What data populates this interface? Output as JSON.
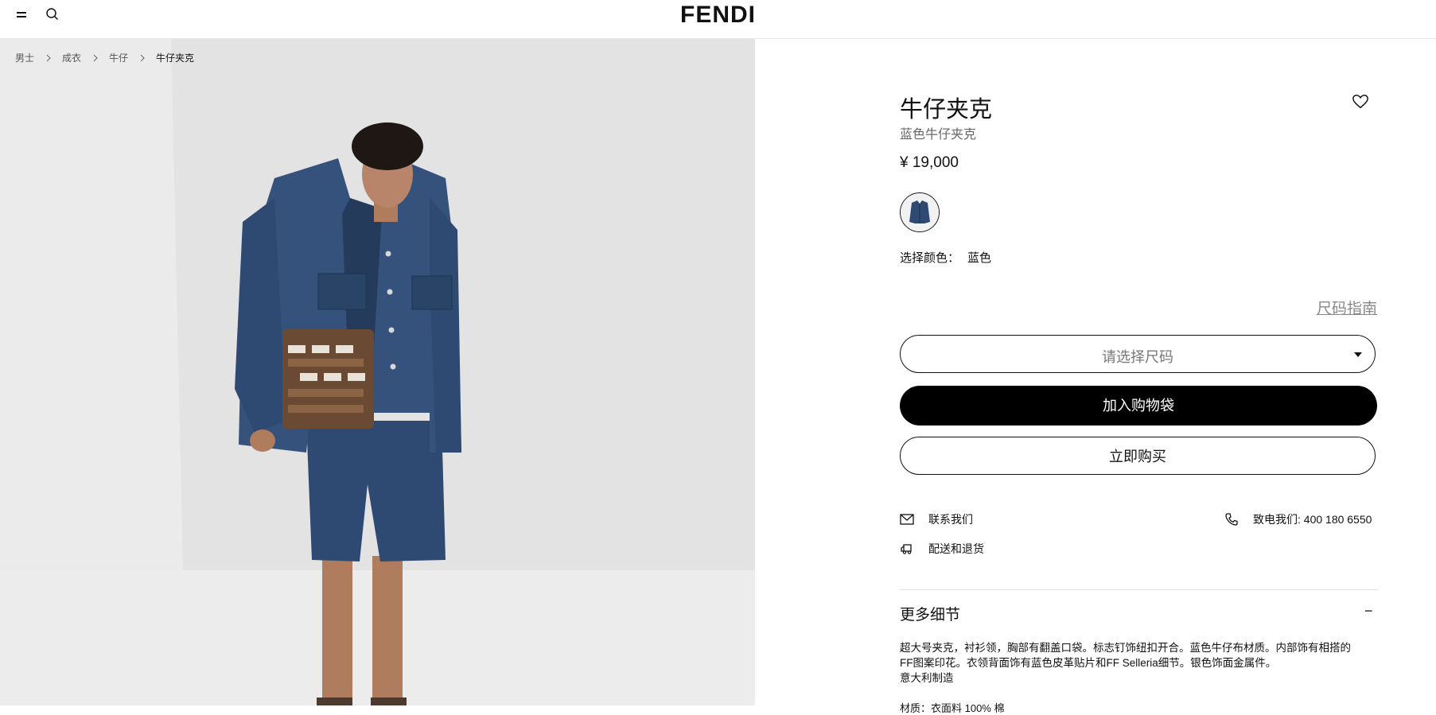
{
  "header": {
    "brand": "FENDI",
    "menu_icon": "hamburger-menu-icon",
    "search_icon": "search-icon"
  },
  "breadcrumb": [
    {
      "label": "男士"
    },
    {
      "label": "成衣"
    },
    {
      "label": "牛仔"
    },
    {
      "label": "牛仔夹克"
    }
  ],
  "product": {
    "title": "牛仔夹克",
    "subtitle": "蓝色牛仔夹克",
    "price": "¥ 19,000",
    "wishlist_icon": "heart-icon",
    "color_label": "选择颜色：",
    "color_value": "蓝色"
  },
  "size": {
    "guide_label": "尺码指南",
    "placeholder": "请选择尺码"
  },
  "actions": {
    "add_to_bag": "加入购物袋",
    "buy_now": "立即购买"
  },
  "service": {
    "contact_label": "联系我们",
    "phone_label": "致电我们: 400 180 6550",
    "delivery_label": "配送和退货"
  },
  "details": {
    "title": "更多细节",
    "toggle": "−",
    "lines": [
      "超大号夹克，衬衫领，胸部有翻盖口袋。标志钉饰纽扣开合。蓝色牛仔布材质。内部饰有相搭的",
      "FF图案印花。衣领背面饰有蓝色皮革贴片和FF Selleria细节。银色饰面金属件。",
      "意大利制造"
    ],
    "materials": "材质：衣面料 100% 棉"
  },
  "colors": {
    "accent": "#000000",
    "denim": "#2f4a72",
    "muted_text": "#777777"
  }
}
